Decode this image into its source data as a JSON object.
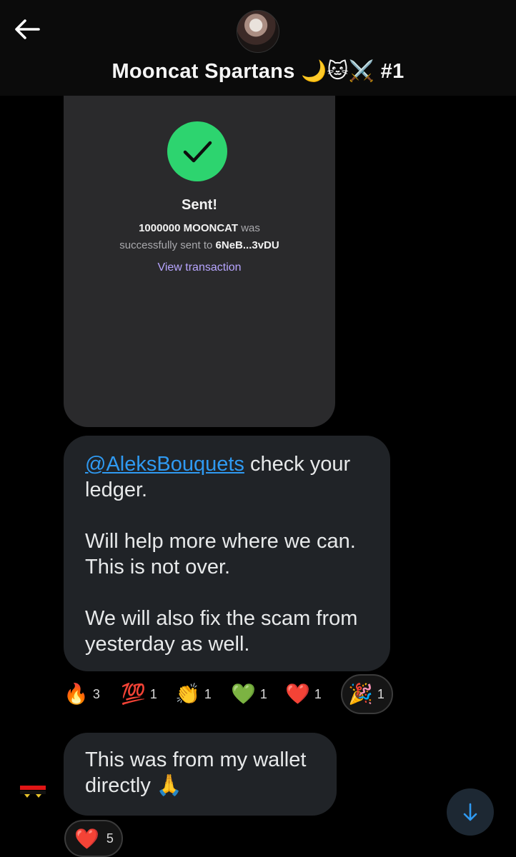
{
  "header": {
    "title": "Mooncat Spartans 🌙🐱⚔️ #1",
    "back_icon": "arrow-left-icon",
    "avatar": "group-avatar"
  },
  "receipt": {
    "check_icon": "checkmark-icon",
    "title": "Sent!",
    "amount": "1000000 MOONCAT",
    "was": "was",
    "line2_prefix": "successfully sent to",
    "address": "6NeB...3vDU",
    "link": "View transaction",
    "colors": {
      "success": "#2dd46f",
      "link": "#b7a5ff"
    }
  },
  "message1": {
    "mention": "@AleksBouquets",
    "line1_rest": " check your",
    "line2": "ledger.",
    "line3": "Will help more where we can.",
    "line4": "This is not over.",
    "line5": "We will also fix the scam from",
    "line6": "yesterday as well."
  },
  "reactions": [
    {
      "emoji": "🔥",
      "count": "3"
    },
    {
      "emoji": "💯",
      "count": "1"
    },
    {
      "emoji": "👏",
      "count": "1"
    },
    {
      "emoji": "💚",
      "count": "1"
    },
    {
      "emoji": "❤️",
      "count": "1"
    },
    {
      "emoji": "🎉",
      "count": "1"
    }
  ],
  "message2": {
    "line1": "This was from my wallet",
    "line2": "directly 🙏",
    "reaction_emoji": "❤️",
    "reaction_count": "5"
  },
  "scroll_button": {
    "icon": "arrow-down-icon",
    "color": "#2f9af2"
  }
}
